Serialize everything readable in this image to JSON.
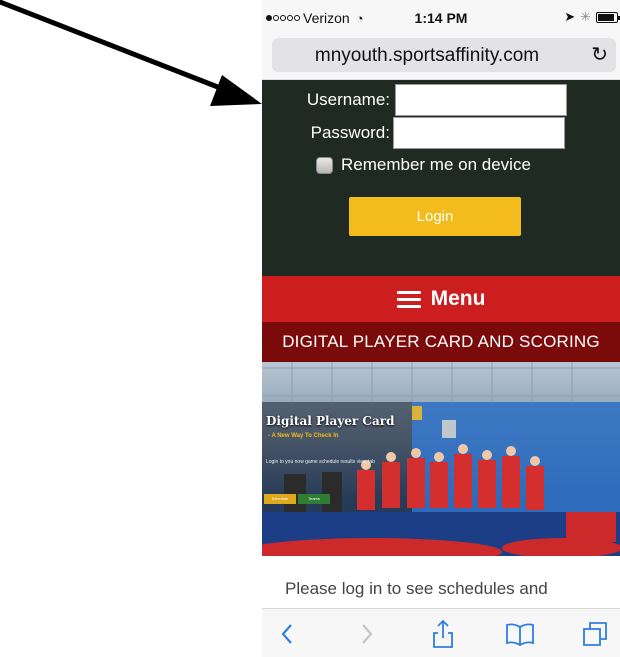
{
  "status_bar": {
    "carrier": "Verizon",
    "time": "1:14 PM",
    "signal_bars_filled": 1,
    "signal_bars_total": 5,
    "battery_level": 0.9
  },
  "browser": {
    "url": "mnyouth.sportsaffinity.com",
    "reload_icon": "reload-icon"
  },
  "login": {
    "username_label": "Username:",
    "password_label": "Password:",
    "username_value": "",
    "password_value": "",
    "remember_label": "Remember me on device",
    "remember_checked": false,
    "login_label": "Login"
  },
  "menu": {
    "label": "Menu",
    "icon": "hamburger-icon"
  },
  "banner": {
    "title": "DIGITAL PLAYER CARD AND SCORING"
  },
  "hero": {
    "title": "Digital Player Card",
    "subtitle": "- A New Way To Check In",
    "text": "Login to you now game schedule results view tab",
    "button_1": "Schedule",
    "button_2": "Teams"
  },
  "content": {
    "text": "Please log in to see schedules and"
  },
  "toolbar": {
    "icons": [
      "back-icon",
      "forward-icon",
      "share-icon",
      "bookmarks-icon",
      "tabs-icon"
    ]
  },
  "colors": {
    "login_bg": "#1f2a22",
    "login_button": "#f4bb1c",
    "menu_bg": "#cc1e1e",
    "banner_bg": "#7b0a0a",
    "toolbar_icon": "#2f7fe0",
    "arrow": "#000000"
  }
}
